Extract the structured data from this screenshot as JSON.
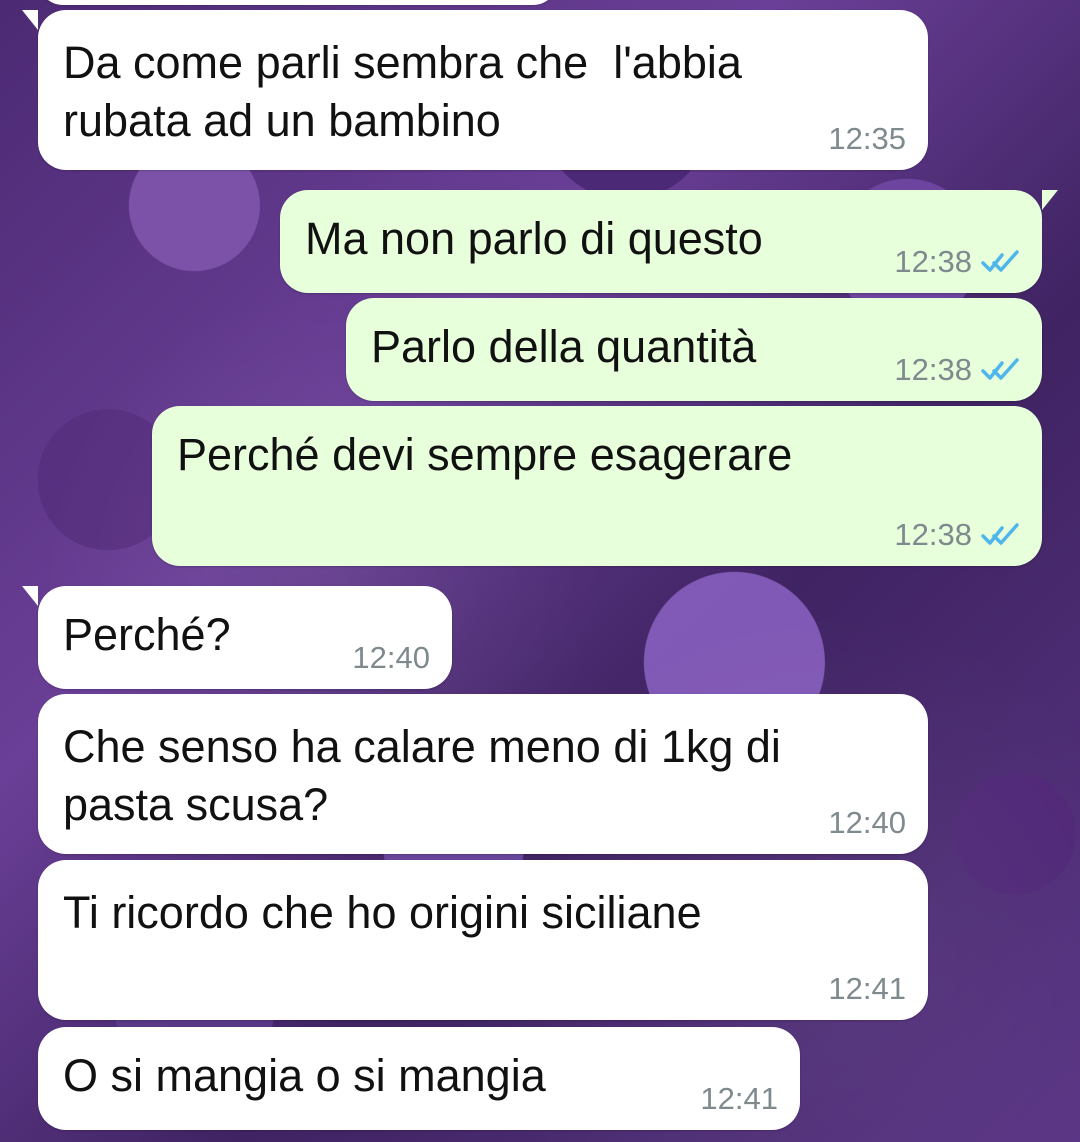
{
  "chat": {
    "messages": [
      {
        "direction": "incoming",
        "text": "Da come parli sembra che  l'abbia\nrubata ad un bambino",
        "time": "12:35"
      },
      {
        "direction": "outgoing",
        "text": "Ma non parlo di questo",
        "time": "12:38",
        "receipt_icon": "double-check-read-icon"
      },
      {
        "direction": "outgoing",
        "text": "Parlo della quantità",
        "time": "12:38",
        "receipt_icon": "double-check-read-icon"
      },
      {
        "direction": "outgoing",
        "text": "Perché devi sempre esagerare",
        "time": "12:38",
        "receipt_icon": "double-check-read-icon"
      },
      {
        "direction": "incoming",
        "text": "Perché?",
        "time": "12:40"
      },
      {
        "direction": "incoming",
        "text": "Che senso ha calare meno di 1kg di\npasta scusa?",
        "time": "12:40"
      },
      {
        "direction": "incoming",
        "text": "Ti ricordo che ho origini siciliane",
        "time": "12:41"
      },
      {
        "direction": "incoming",
        "text": "O si mangia o si mangia",
        "time": "12:41"
      }
    ]
  },
  "theme": {
    "incoming_bubble": "#ffffff",
    "outgoing_bubble": "#e7ffdb",
    "text_color": "#111111",
    "meta_color": "#7f8a8f",
    "read_receipt_color": "#4fb6ec",
    "wallpaper_accent": "#6a3f97"
  }
}
